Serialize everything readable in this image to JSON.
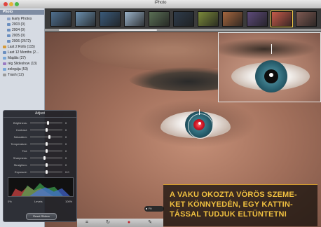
{
  "window": {
    "title": "iPhoto"
  },
  "sidebar": {
    "header": "Photo",
    "items": [
      {
        "label": "Early Photos",
        "level": 1,
        "icon": "folder-icon",
        "color": "#8aa1c4"
      },
      {
        "label": "2003 (0)",
        "level": 1,
        "icon": "calendar-icon",
        "color": "#6c8fbf"
      },
      {
        "label": "2004 (0)",
        "level": 1,
        "icon": "calendar-icon",
        "color": "#6c8fbf"
      },
      {
        "label": "2005 (0)",
        "level": 1,
        "icon": "calendar-icon",
        "color": "#6c8fbf"
      },
      {
        "label": "2006 (2572)",
        "level": 1,
        "icon": "calendar-icon",
        "color": "#6c8fbf"
      },
      {
        "label": "Last 2 Rolls (115)",
        "level": 2,
        "icon": "roll-icon",
        "color": "#d59a3a"
      },
      {
        "label": "Last 12 Months (2...",
        "level": 2,
        "icon": "calendar-icon",
        "color": "#6c8fbf"
      },
      {
        "label": "Majális (27)",
        "level": 2,
        "icon": "album-icon",
        "color": "#7aa8d8"
      },
      {
        "label": "rég Slideshow (13)",
        "level": 2,
        "icon": "slideshow-icon",
        "color": "#9b7bc2"
      },
      {
        "label": "zelegája (53)",
        "level": 2,
        "icon": "album-icon",
        "color": "#7aa8d8"
      },
      {
        "label": "Trash (12)",
        "level": 2,
        "icon": "trash-icon",
        "color": "#9a9a9a"
      }
    ]
  },
  "filmstrip": {
    "thumbs": [
      {
        "color": "#4f6f8f",
        "selected": false
      },
      {
        "color": "#6b8fae",
        "selected": false
      },
      {
        "color": "#3a5a7a",
        "selected": false
      },
      {
        "color": "#9ab2c8",
        "selected": false
      },
      {
        "color": "#5a6f55",
        "selected": false
      },
      {
        "color": "#2e3b4a",
        "selected": false
      },
      {
        "color": "#7b8a3a",
        "selected": false
      },
      {
        "color": "#a5663e",
        "selected": false
      },
      {
        "color": "#5d4a7a",
        "selected": false
      },
      {
        "color": "#c65a4a",
        "selected": true
      },
      {
        "color": "#7f5a52",
        "selected": false
      }
    ]
  },
  "adjust": {
    "title": "Adjust",
    "sliders": [
      {
        "label": "Brightness:",
        "value": "0",
        "level": 0.55
      },
      {
        "label": "Contrast:",
        "value": "0",
        "level": 0.5
      },
      {
        "label": "Saturation:",
        "value": "0",
        "level": 0.6
      },
      {
        "label": "Temperature:",
        "value": "0",
        "level": 0.5
      },
      {
        "label": "Tint:",
        "value": "0",
        "level": 0.5
      },
      {
        "label": "Sharpness:",
        "value": "0",
        "level": 0.45
      },
      {
        "label": "Straighten:",
        "value": "0",
        "level": 0.5
      },
      {
        "label": "Exposure:",
        "value": "0.0",
        "level": 0.5
      }
    ],
    "levels_low": "0%",
    "levels_label": "Levels",
    "levels_high": "100%",
    "reset_label": "Reset Sliders"
  },
  "caption": {
    "lines": [
      "A VAKU OKOZTA VÖRÖS SZEME-",
      "KET KÖNNYEDÉN, EGY KATTIN-",
      "TÁSSAL TUDJUK ELTÜNTETNI"
    ],
    "color": "#f0c040"
  },
  "toolbar": {
    "fit_label": "Fit",
    "tools": [
      "crop-icon",
      "rotate-icon",
      "red-eye-icon",
      "retouch-icon"
    ]
  }
}
